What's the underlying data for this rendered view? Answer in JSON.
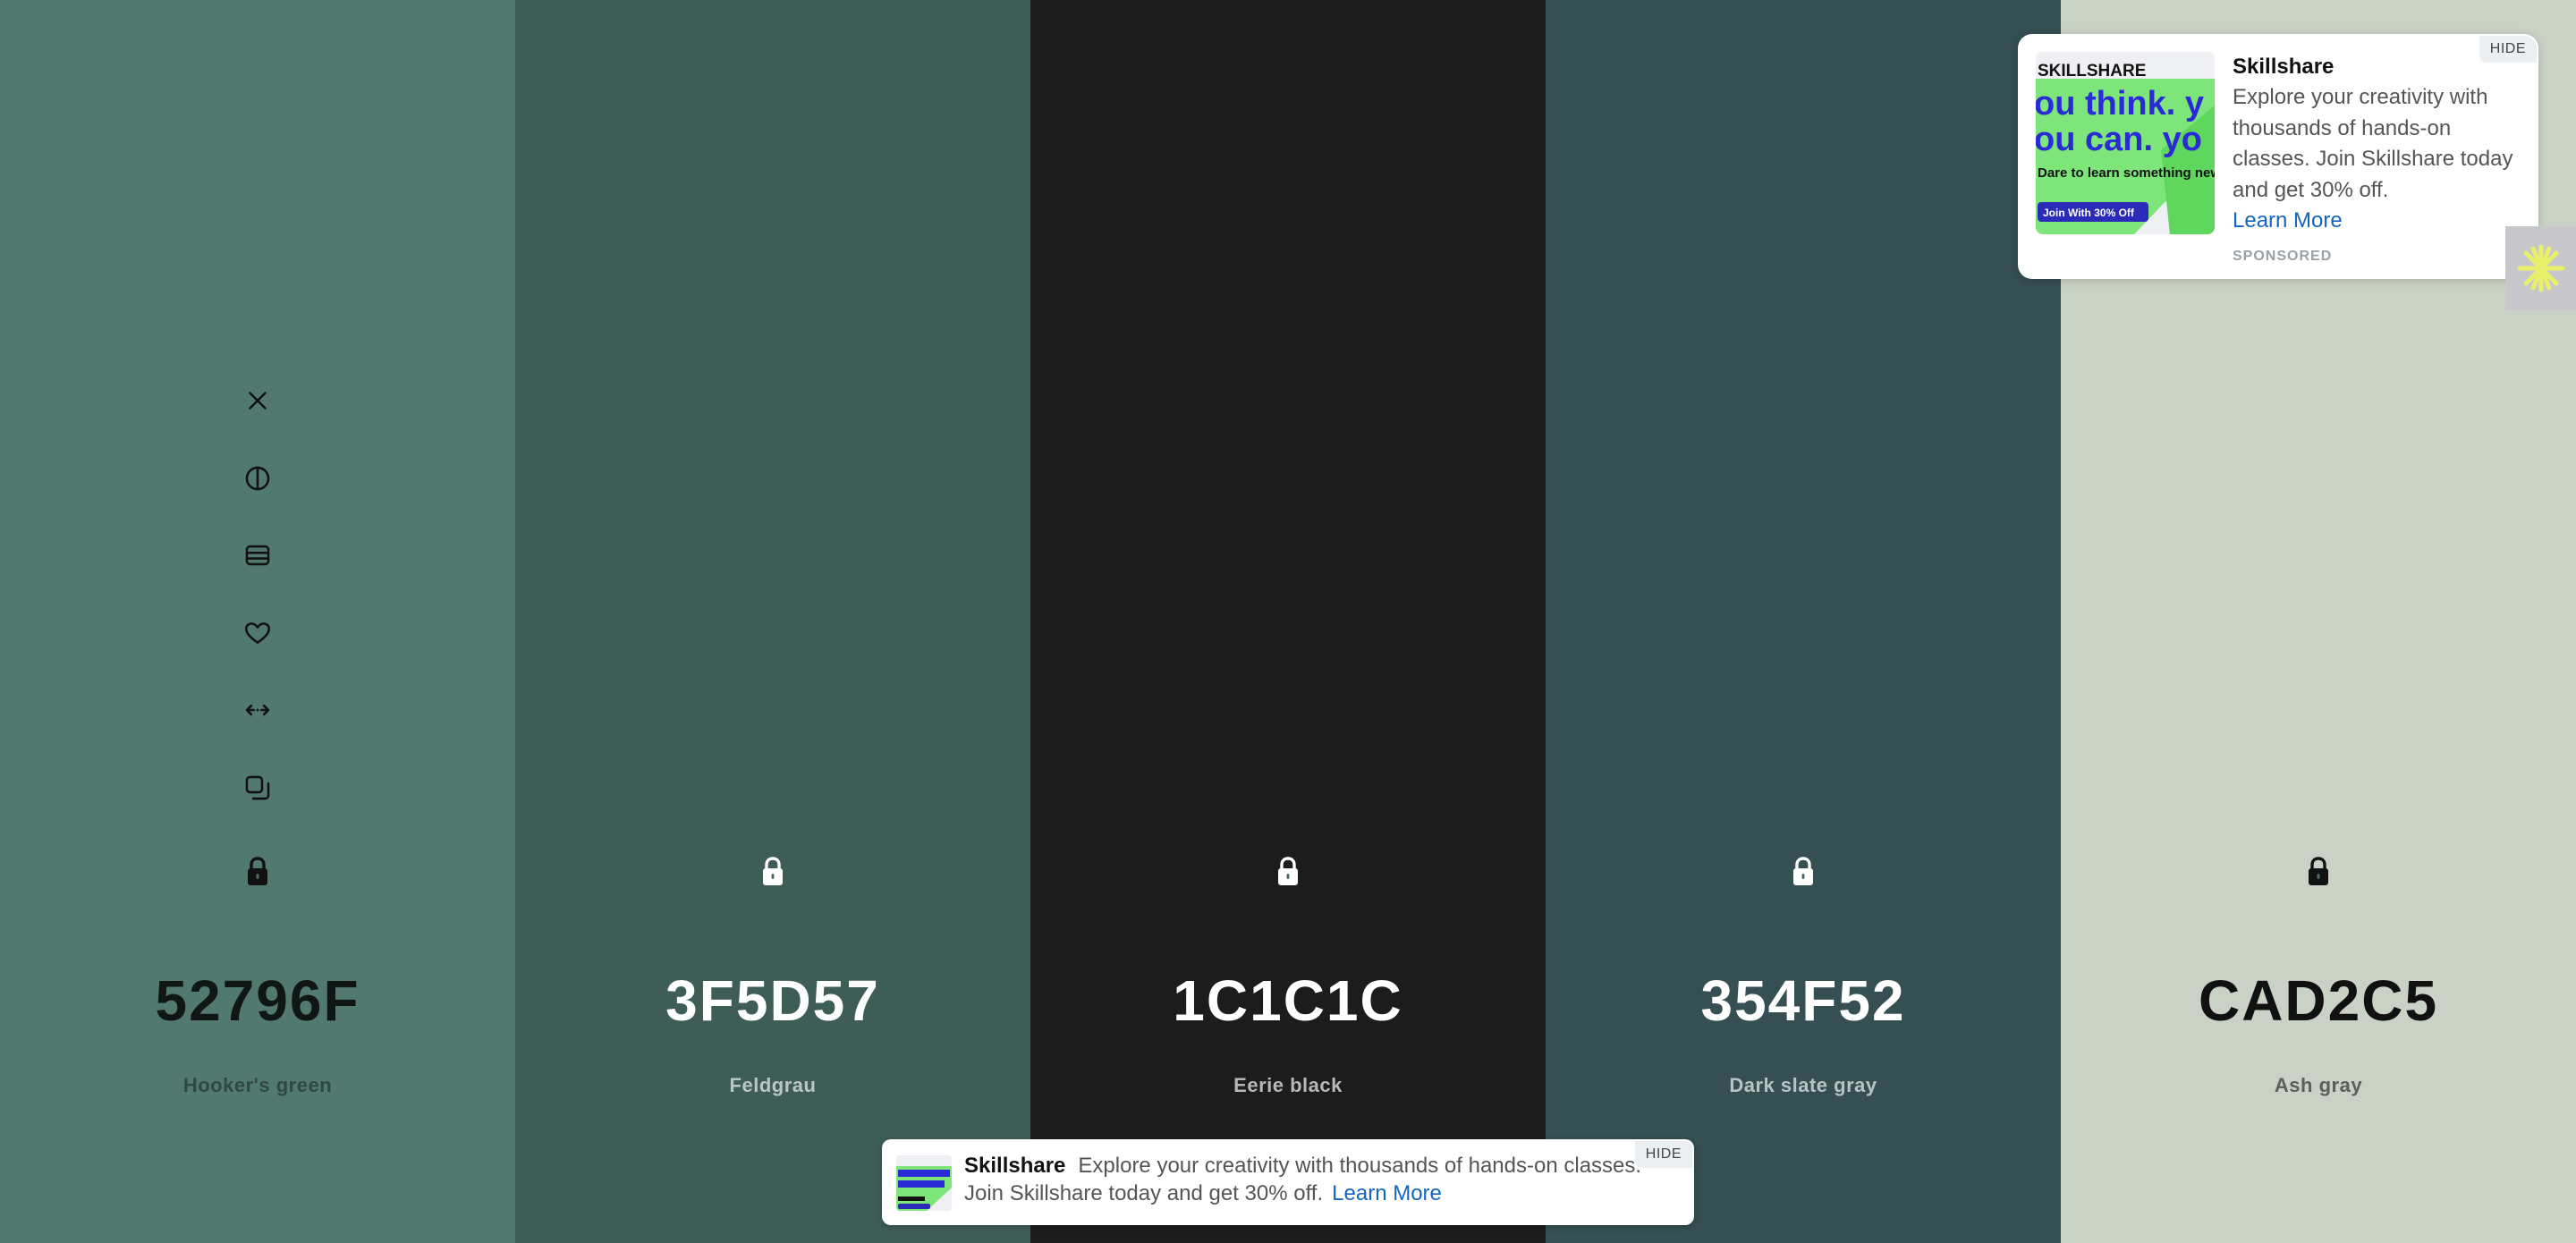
{
  "swatches": [
    {
      "hex": "52796F",
      "name": "Hooker's green",
      "bg": "#52796F",
      "hex_color": "#0f1614",
      "name_color": "#2f4842",
      "icon_color": "#111111",
      "show_tools": true
    },
    {
      "hex": "3F5D57",
      "name": "Feldgrau",
      "bg": "#3F5D57",
      "hex_color": "#ffffff",
      "name_color": "#b9c6c3",
      "icon_color": "#ffffff",
      "show_tools": false
    },
    {
      "hex": "1C1C1C",
      "name": "Eerie black",
      "bg": "#1C1C1C",
      "hex_color": "#ffffff",
      "name_color": "#b7b7b7",
      "icon_color": "#ffffff",
      "show_tools": false
    },
    {
      "hex": "354F52",
      "name": "Dark slate gray",
      "bg": "#354F52",
      "hex_color": "#ffffff",
      "name_color": "#b7c3c4",
      "icon_color": "#ffffff",
      "show_tools": false
    },
    {
      "hex": "CAD2C5",
      "name": "Ash gray",
      "bg": "#CAD2C5",
      "hex_color": "#111111",
      "name_color": "#5b6058",
      "icon_color": "#111111",
      "show_tools": false
    }
  ],
  "tools": [
    "close-icon",
    "contrast-icon",
    "shades-icon",
    "heart-icon",
    "drag-icon",
    "copy-icon"
  ],
  "ad": {
    "hide_label": "HIDE",
    "title": "Skillshare",
    "description": "Explore your creativity with thousands of hands-on classes. Join Skillshare today and get 30% off.",
    "link": "Learn More",
    "sponsored": "SPONSORED",
    "thumb_brand": "SKILLSHARE",
    "thumb_headline_1": "ou think. y",
    "thumb_headline_2": "ou can. yo",
    "thumb_tagline": "Dare to learn something new.",
    "thumb_cta": "Join With 30% Off"
  },
  "bottom_ad": {
    "hide_label": "HIDE",
    "title": "Skillshare",
    "description": "Explore your creativity with thousands of hands-on classes. Join Skillshare today and get 30% off.",
    "link": "Learn More"
  },
  "side_tab_icon": "asterisk-icon",
  "colors": {
    "accent_link": "#1565c0",
    "side_tab_star": "#e8f06a"
  }
}
